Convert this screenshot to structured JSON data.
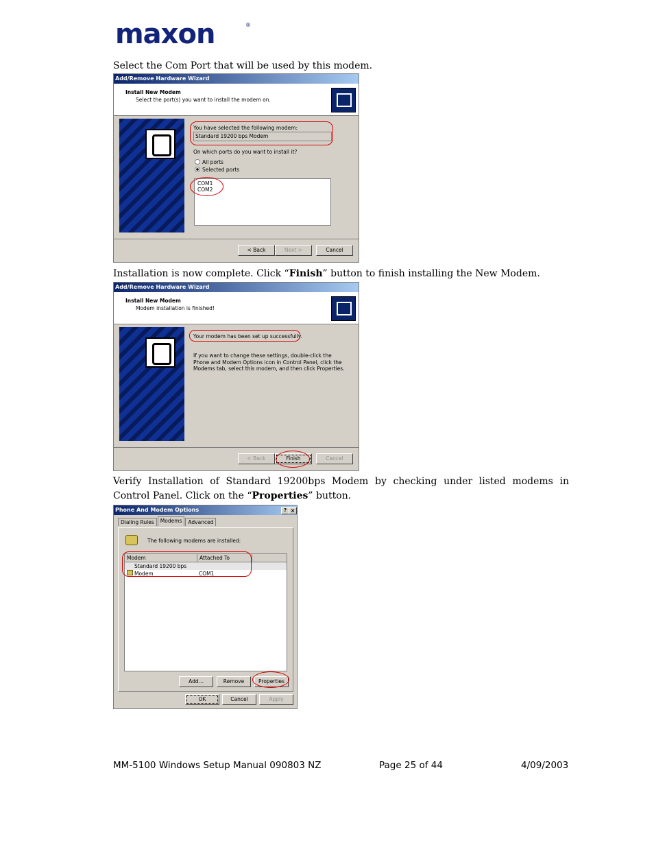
{
  "logo": {
    "text": "maxon",
    "reg": "®"
  },
  "step1": {
    "instruction": "Select the Com Port that will be used by this modem.",
    "dialog": {
      "title": "Add/Remove Hardware Wizard",
      "header_title": "Install New Modem",
      "header_sub": "Select the port(s) you want to install the modem on.",
      "selected_label": "You have selected the following modem:",
      "modem_value": "Standard 19200 bps Modem",
      "ports_question": "On which ports do you want to install it?",
      "radio_all": "All ports",
      "radio_selected": "Selected ports",
      "ports": [
        "COM1",
        "COM2"
      ],
      "back": "< Back",
      "next": "Next >",
      "cancel": "Cancel"
    }
  },
  "step2": {
    "instruction_pre": "Installation is now complete. Click “",
    "instruction_bold": "Finish",
    "instruction_post": "” button to finish installing the New Modem.",
    "dialog": {
      "title": "Add/Remove Hardware Wizard",
      "header_title": "Install New Modem",
      "header_sub": "Modem installation is finished!",
      "success": "Your modem has been set up successfully.",
      "info_lines": [
        "If you want to change these settings, double-click the",
        "Phone and Modem Options icon in Control Panel, click the",
        "Modems tab, select this modem, and then click Properties."
      ],
      "back": "< Back",
      "finish": "Finish",
      "cancel": "Cancel"
    }
  },
  "step3": {
    "line1": "Verify Installation of Standard 19200bps Modem by checking under listed modems in",
    "line2_pre": "Control Panel. Click on the “",
    "line2_bold": "Properties",
    "line2_post": "” button.",
    "dialog": {
      "title": "Phone And Modem Options",
      "help": "?",
      "close": "×",
      "tabs": [
        "Dialing Rules",
        "Modems",
        "Advanced"
      ],
      "installed_text": "The following modems are installed:",
      "col_modem": "Modem",
      "col_attached": "Attached To",
      "row_modem": "Standard 19200 bps Modem",
      "row_port": "COM1",
      "add": "Add...",
      "remove": "Remove",
      "properties": "Properties",
      "ok": "OK",
      "cancel": "Cancel",
      "apply": "Apply"
    }
  },
  "footer": {
    "doc": "MM-5100 Windows Setup Manual 090803 NZ",
    "page": "Page 25 of 44",
    "date": "4/09/2003"
  }
}
